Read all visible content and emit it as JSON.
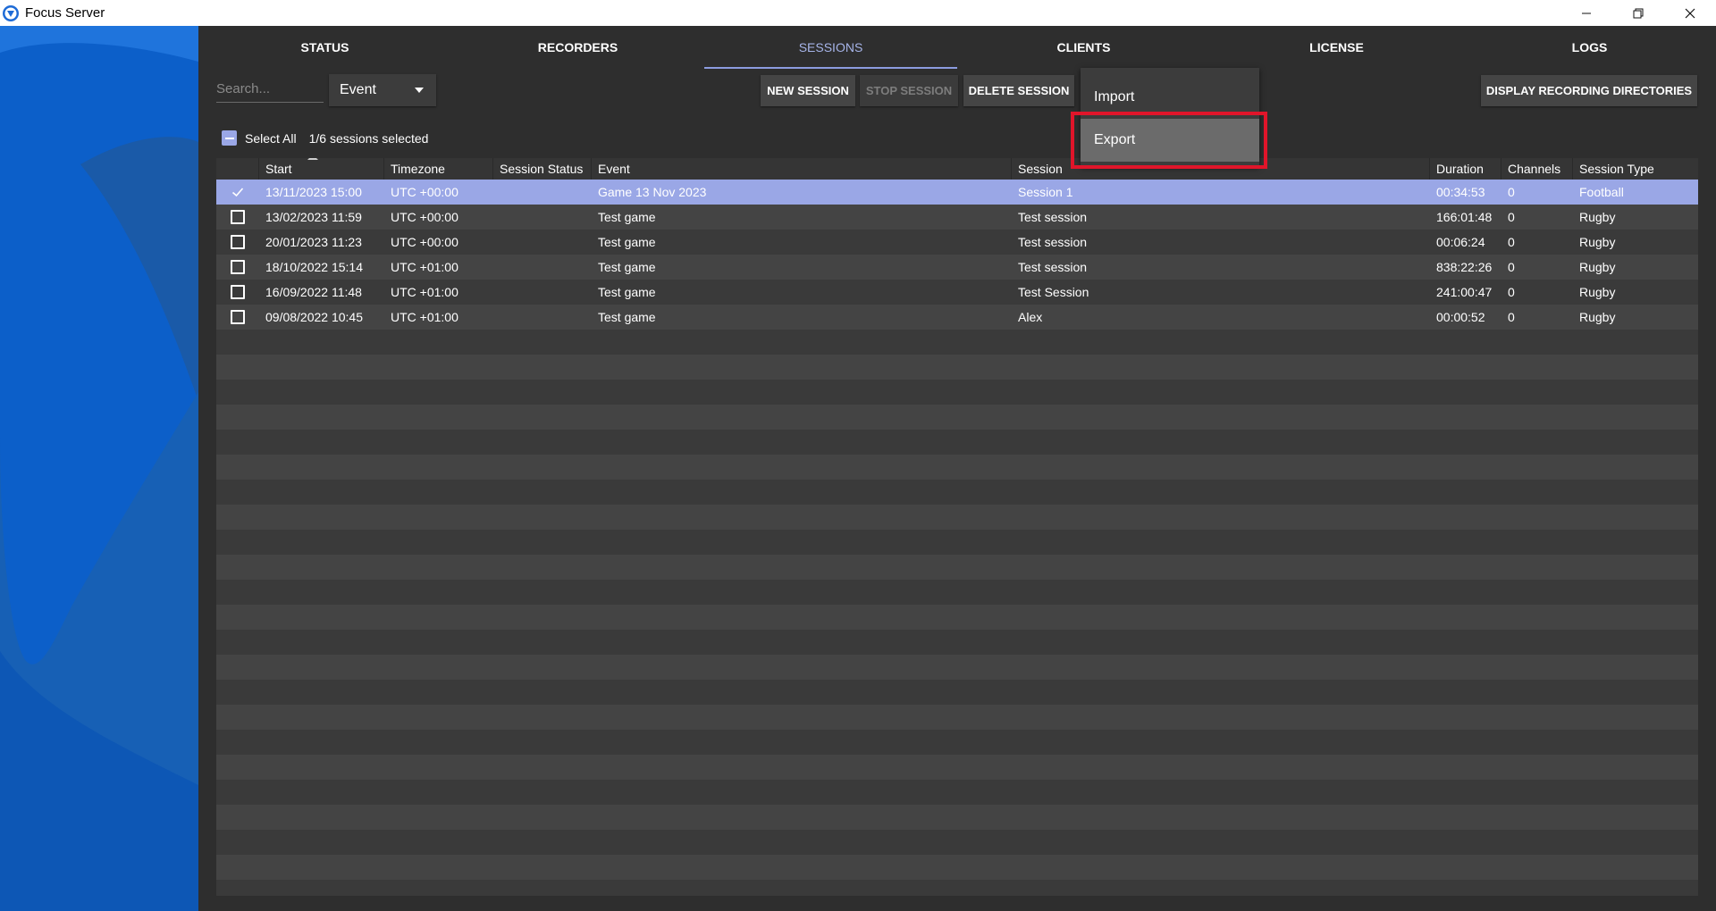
{
  "window": {
    "title": "Focus Server"
  },
  "tabs": [
    {
      "label": "STATUS",
      "active": false
    },
    {
      "label": "RECORDERS",
      "active": false
    },
    {
      "label": "SESSIONS",
      "active": true
    },
    {
      "label": "CLIENTS",
      "active": false
    },
    {
      "label": "LICENSE",
      "active": false
    },
    {
      "label": "LOGS",
      "active": false
    }
  ],
  "toolbar": {
    "search_placeholder": "Search...",
    "filter_value": "Event",
    "new_session": "NEW SESSION",
    "stop_session": "STOP SESSION",
    "delete_session": "DELETE SESSION",
    "display_dirs": "DISPLAY RECORDING DIRECTORIES"
  },
  "menu": {
    "import": "Import",
    "export": "Export"
  },
  "selection": {
    "select_all_label": "Select All",
    "count_text": "1/6 sessions selected"
  },
  "table": {
    "columns": [
      "Start",
      "Timezone",
      "Session Status",
      "Event",
      "Session",
      "Duration",
      "Channels",
      "Session Type"
    ],
    "rows": [
      {
        "checked": true,
        "start": "13/11/2023 15:00",
        "timezone": "UTC +00:00",
        "status": "",
        "event": "Game 13 Nov 2023",
        "session": "Session 1",
        "duration": "00:34:53",
        "channels": "0",
        "type": "Football"
      },
      {
        "checked": false,
        "start": "13/02/2023 11:59",
        "timezone": "UTC +00:00",
        "status": "",
        "event": "Test game",
        "session": "Test session",
        "duration": "166:01:48",
        "channels": "0",
        "type": "Rugby"
      },
      {
        "checked": false,
        "start": "20/01/2023 11:23",
        "timezone": "UTC +00:00",
        "status": "",
        "event": "Test game",
        "session": "Test session",
        "duration": "00:06:24",
        "channels": "0",
        "type": "Rugby"
      },
      {
        "checked": false,
        "start": "18/10/2022 15:14",
        "timezone": "UTC +01:00",
        "status": "",
        "event": "Test game",
        "session": "Test session",
        "duration": "838:22:26",
        "channels": "0",
        "type": "Rugby"
      },
      {
        "checked": false,
        "start": "16/09/2022 11:48",
        "timezone": "UTC +01:00",
        "status": "",
        "event": "Test game",
        "session": "Test Session",
        "duration": "241:00:47",
        "channels": "0",
        "type": "Rugby"
      },
      {
        "checked": false,
        "start": "09/08/2022 10:45",
        "timezone": "UTC +01:00",
        "status": "",
        "event": "Test game",
        "session": "Alex",
        "duration": "00:00:52",
        "channels": "0",
        "type": "Rugby"
      }
    ]
  },
  "colors": {
    "accent": "#9aa7e6",
    "highlight_border": "#e0152a",
    "left_panel": "#1565c0"
  }
}
